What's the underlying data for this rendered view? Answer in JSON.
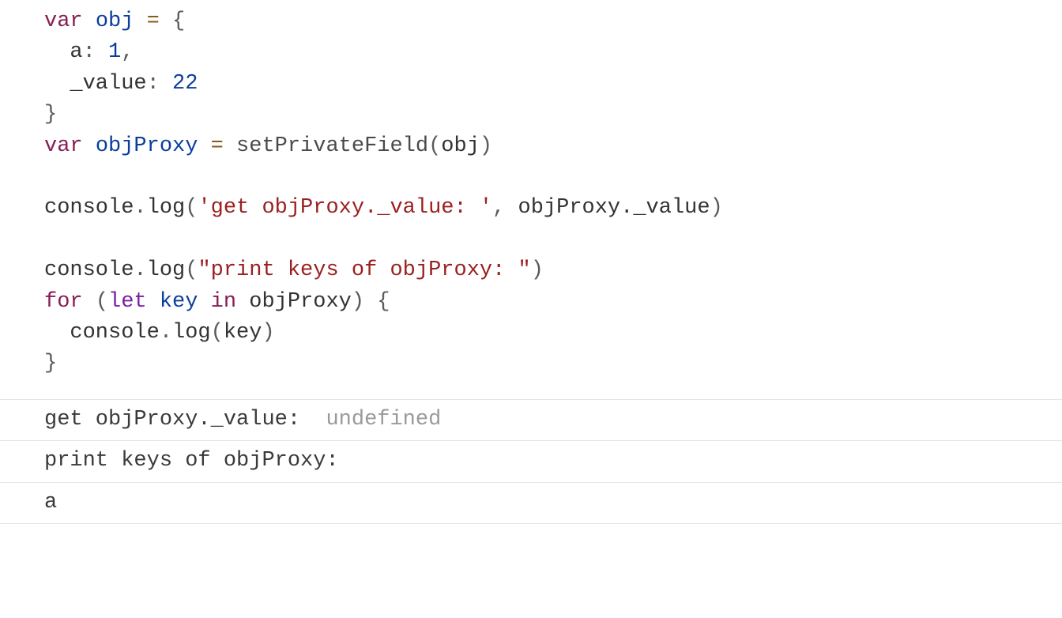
{
  "code": {
    "l1": {
      "kw": "var",
      "name": "obj",
      "eq": "=",
      "brace": "{"
    },
    "l2": {
      "indent": "  ",
      "key": "a",
      "colon": ":",
      "num": "1",
      "comma": ","
    },
    "l3": {
      "indent": "  ",
      "key": "_value",
      "colon": ":",
      "num": "22"
    },
    "l4": {
      "brace": "}"
    },
    "l5": {
      "kw": "var",
      "name": "objProxy",
      "eq": "=",
      "fn": "setPrivateField",
      "lp": "(",
      "arg": "obj",
      "rp": ")"
    },
    "l6": "",
    "l7": {
      "obj": "console",
      "dot": ".",
      "fn": "log",
      "lp": "(",
      "str": "'get objProxy._value: '",
      "comma": ",",
      "sp": " ",
      "expr": "objProxy._value",
      "rp": ")"
    },
    "l8": "",
    "l9": {
      "obj": "console",
      "dot": ".",
      "fn": "log",
      "lp": "(",
      "str": "\"print keys of objProxy: \"",
      "rp": ")"
    },
    "l10": {
      "kw": "for",
      "lp": "(",
      "let": "let",
      "var": "key",
      "in": "in",
      "iter": "objProxy",
      "rp": ")",
      "brace": "{"
    },
    "l11": {
      "indent": "  ",
      "obj": "console",
      "dot": ".",
      "fn": "log",
      "lp": "(",
      "arg": "key",
      "rp": ")"
    },
    "l12": {
      "brace": "}"
    }
  },
  "console": {
    "row1": {
      "label": "get objProxy._value:  ",
      "value": "undefined"
    },
    "row2": {
      "label": "print keys of objProxy: "
    },
    "row3": {
      "label": "a"
    }
  }
}
